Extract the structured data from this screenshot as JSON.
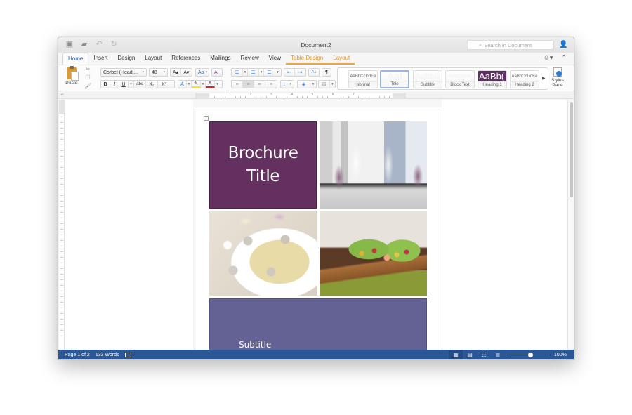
{
  "window": {
    "title": "Document2",
    "search_placeholder": "Search in Document"
  },
  "quick_access": {
    "icons": [
      "save-icon",
      "open-folder-icon",
      "undo-icon",
      "redo-icon"
    ]
  },
  "tabs": [
    {
      "label": "Home",
      "active": true,
      "contextual": false
    },
    {
      "label": "Insert",
      "active": false,
      "contextual": false
    },
    {
      "label": "Design",
      "active": false,
      "contextual": false
    },
    {
      "label": "Layout",
      "active": false,
      "contextual": false
    },
    {
      "label": "References",
      "active": false,
      "contextual": false
    },
    {
      "label": "Mailings",
      "active": false,
      "contextual": false
    },
    {
      "label": "Review",
      "active": false,
      "contextual": false
    },
    {
      "label": "View",
      "active": false,
      "contextual": false
    },
    {
      "label": "Table Design",
      "active": false,
      "contextual": true
    },
    {
      "label": "Layout",
      "active": false,
      "contextual": true
    }
  ],
  "ribbon": {
    "clipboard": {
      "paste_label": "Paste"
    },
    "font": {
      "name": "Corbel (Headi...",
      "size": "48",
      "grow_label": "A▴",
      "shrink_label": "A▾",
      "change_case_label": "Aa",
      "clear_format_label": "A",
      "bold": "B",
      "italic": "I",
      "underline": "U",
      "strikethrough": "abc",
      "subscript": "X₂",
      "superscript": "X²",
      "text_effects": "A",
      "highlight": "✎",
      "font_color": "A",
      "highlight_color": "#f5e12a",
      "font_color_swatch": "#e02020"
    },
    "paragraph": {
      "show_marks": "¶",
      "sort": "A↓"
    },
    "styles": [
      {
        "preview": "AaBbCcDdEe",
        "label": "Normal",
        "selected": false
      },
      {
        "preview": "AaI",
        "label": "Title",
        "selected": true
      },
      {
        "preview": "AaBbG",
        "label": "Subtitle",
        "selected": false
      },
      {
        "preview": "AaBbCcDdE",
        "label": "Block Text",
        "selected": false
      },
      {
        "preview": "AaBb(",
        "label": "Heading 1",
        "selected": false
      },
      {
        "preview": "AaBbCcDdEe",
        "label": "Heading 2",
        "selected": false
      }
    ],
    "styles_pane_label": "Styles Pane"
  },
  "ruler": {
    "numbers": [
      "1",
      "2",
      "3",
      "4",
      "5",
      "6",
      "7"
    ]
  },
  "document": {
    "title_text_line1": "Brochure",
    "title_text_line2": "Title",
    "subtitle_text": "Subtitle",
    "title_color": "#64305f",
    "subtitle_color": "#646195",
    "images": [
      "wine-glasses-photo",
      "clam-pasta-photo",
      "shrimp-lettuce-wraps-photo"
    ]
  },
  "status": {
    "page": "Page 1 of 2",
    "words": "133 Words",
    "zoom": "100%",
    "zoom_fraction": 0.5,
    "bar_color": "#2b5797"
  }
}
